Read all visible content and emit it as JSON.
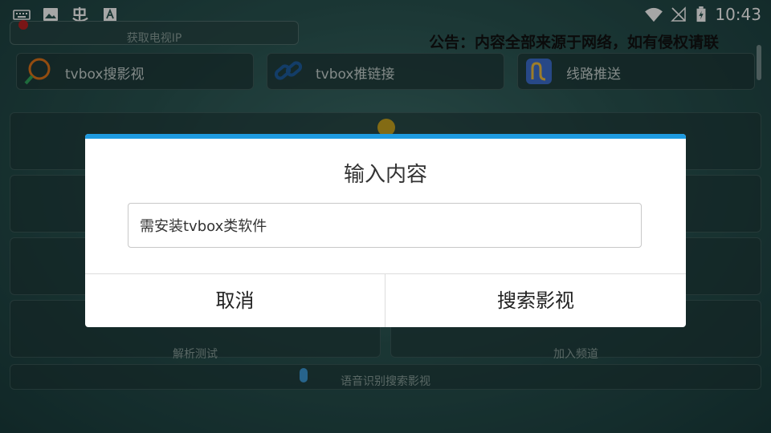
{
  "statusbar": {
    "time": "10:43"
  },
  "app": {
    "top_button": "获取电视IP",
    "notice": "公告：内容全部来源于网络，如有侵权请联",
    "tiles": [
      {
        "label": "tvbox搜影视",
        "icon": "search-icon"
      },
      {
        "label": "tvbox推链接",
        "icon": "link-icon"
      },
      {
        "label": "线路推送",
        "icon": "route-icon"
      }
    ],
    "left_bottom_button": "解析测试",
    "right_bottom_button": "加入频道",
    "voice_button": "语音识别搜索影视"
  },
  "dialog": {
    "title": "输入内容",
    "input_value": "需安装tvbox类软件",
    "cancel": "取消",
    "confirm": "搜索影视"
  },
  "colors": {
    "accent": "#1e9be0"
  }
}
